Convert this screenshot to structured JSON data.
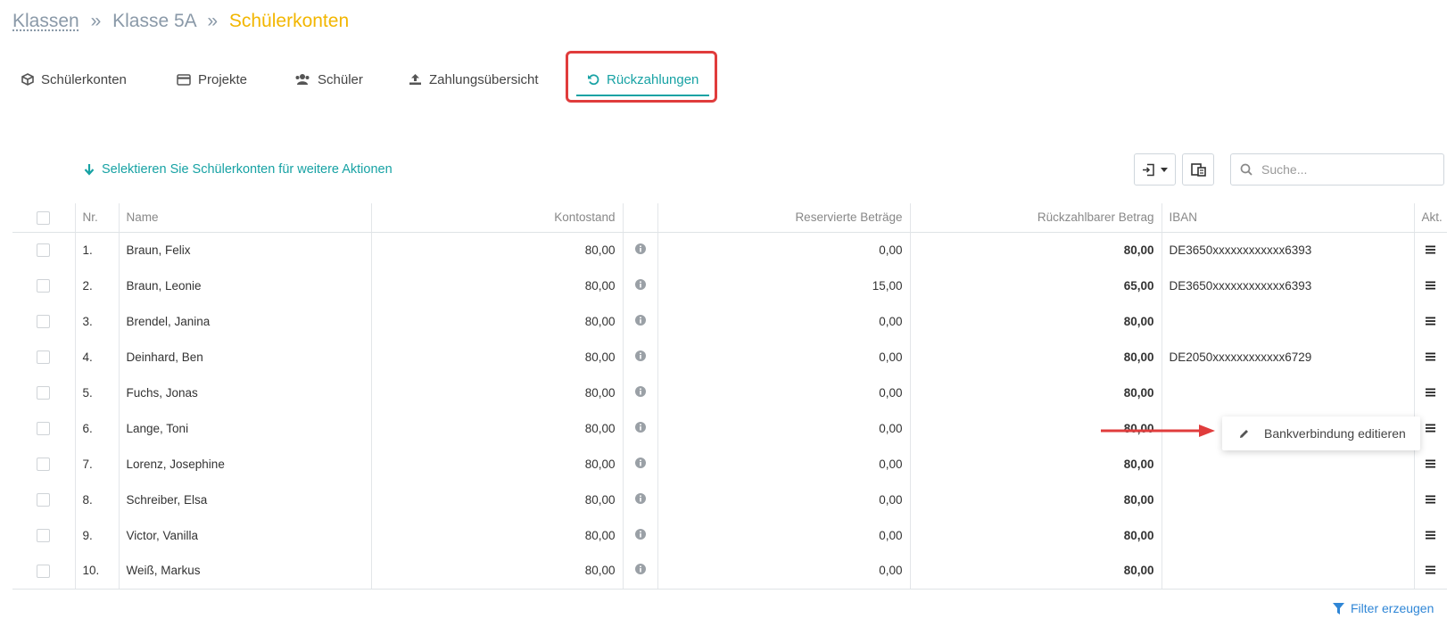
{
  "breadcrumb": {
    "root": "Klassen",
    "sep1": "»",
    "middle": "Klasse 5A",
    "sep2": "»",
    "current": "Schülerkonten"
  },
  "tabs": [
    {
      "label": "Schülerkonten",
      "icon": "cube-icon"
    },
    {
      "label": "Projekte",
      "icon": "credit-card-icon"
    },
    {
      "label": "Schüler",
      "icon": "users-icon"
    },
    {
      "label": "Zahlungsübersicht",
      "icon": "upload-icon"
    },
    {
      "label": "Rückzahlungen",
      "icon": "undo-icon",
      "active": true
    }
  ],
  "toolbar": {
    "select_hint": "Selektieren Sie Schülerkonten für weitere Aktionen",
    "search_placeholder": "Suche..."
  },
  "table": {
    "headers": {
      "nr": "Nr.",
      "name": "Name",
      "kontostand": "Kontostand",
      "reserviert": "Reservierte Beträge",
      "rueckzahlbar": "Rückzahlbarer Betrag",
      "iban": "IBAN",
      "akt": "Akt."
    },
    "rows": [
      {
        "nr": "1.",
        "name": "Braun, Felix",
        "kontostand": "80,00",
        "reserviert": "0,00",
        "rueckzahlbar": "80,00",
        "iban": "DE3650xxxxxxxxxxxx6393"
      },
      {
        "nr": "2.",
        "name": "Braun, Leonie",
        "kontostand": "80,00",
        "reserviert": "15,00",
        "rueckzahlbar": "65,00",
        "iban": "DE3650xxxxxxxxxxxx6393"
      },
      {
        "nr": "3.",
        "name": "Brendel, Janina",
        "kontostand": "80,00",
        "reserviert": "0,00",
        "rueckzahlbar": "80,00",
        "iban": ""
      },
      {
        "nr": "4.",
        "name": "Deinhard, Ben",
        "kontostand": "80,00",
        "reserviert": "0,00",
        "rueckzahlbar": "80,00",
        "iban": "DE2050xxxxxxxxxxxx6729"
      },
      {
        "nr": "5.",
        "name": "Fuchs, Jonas",
        "kontostand": "80,00",
        "reserviert": "0,00",
        "rueckzahlbar": "80,00",
        "iban": ""
      },
      {
        "nr": "6.",
        "name": "Lange, Toni",
        "kontostand": "80,00",
        "reserviert": "0,00",
        "rueckzahlbar": "80,00",
        "iban": ""
      },
      {
        "nr": "7.",
        "name": "Lorenz, Josephine",
        "kontostand": "80,00",
        "reserviert": "0,00",
        "rueckzahlbar": "80,00",
        "iban": ""
      },
      {
        "nr": "8.",
        "name": "Schreiber, Elsa",
        "kontostand": "80,00",
        "reserviert": "0,00",
        "rueckzahlbar": "80,00",
        "iban": ""
      },
      {
        "nr": "9.",
        "name": "Victor, Vanilla",
        "kontostand": "80,00",
        "reserviert": "0,00",
        "rueckzahlbar": "80,00",
        "iban": ""
      },
      {
        "nr": "10.",
        "name": "Weiß, Markus",
        "kontostand": "80,00",
        "reserviert": "0,00",
        "rueckzahlbar": "80,00",
        "iban": ""
      }
    ]
  },
  "context_menu": {
    "item": "Bankverbindung editieren"
  },
  "footer": {
    "filter_label": "Filter erzeugen"
  },
  "colors": {
    "accent": "#17a2a4",
    "breadcrumb_current": "#f2b600",
    "amount_green": "#2a9a2a",
    "annotation_red": "#e03c3c",
    "link_blue": "#2f86d6"
  }
}
